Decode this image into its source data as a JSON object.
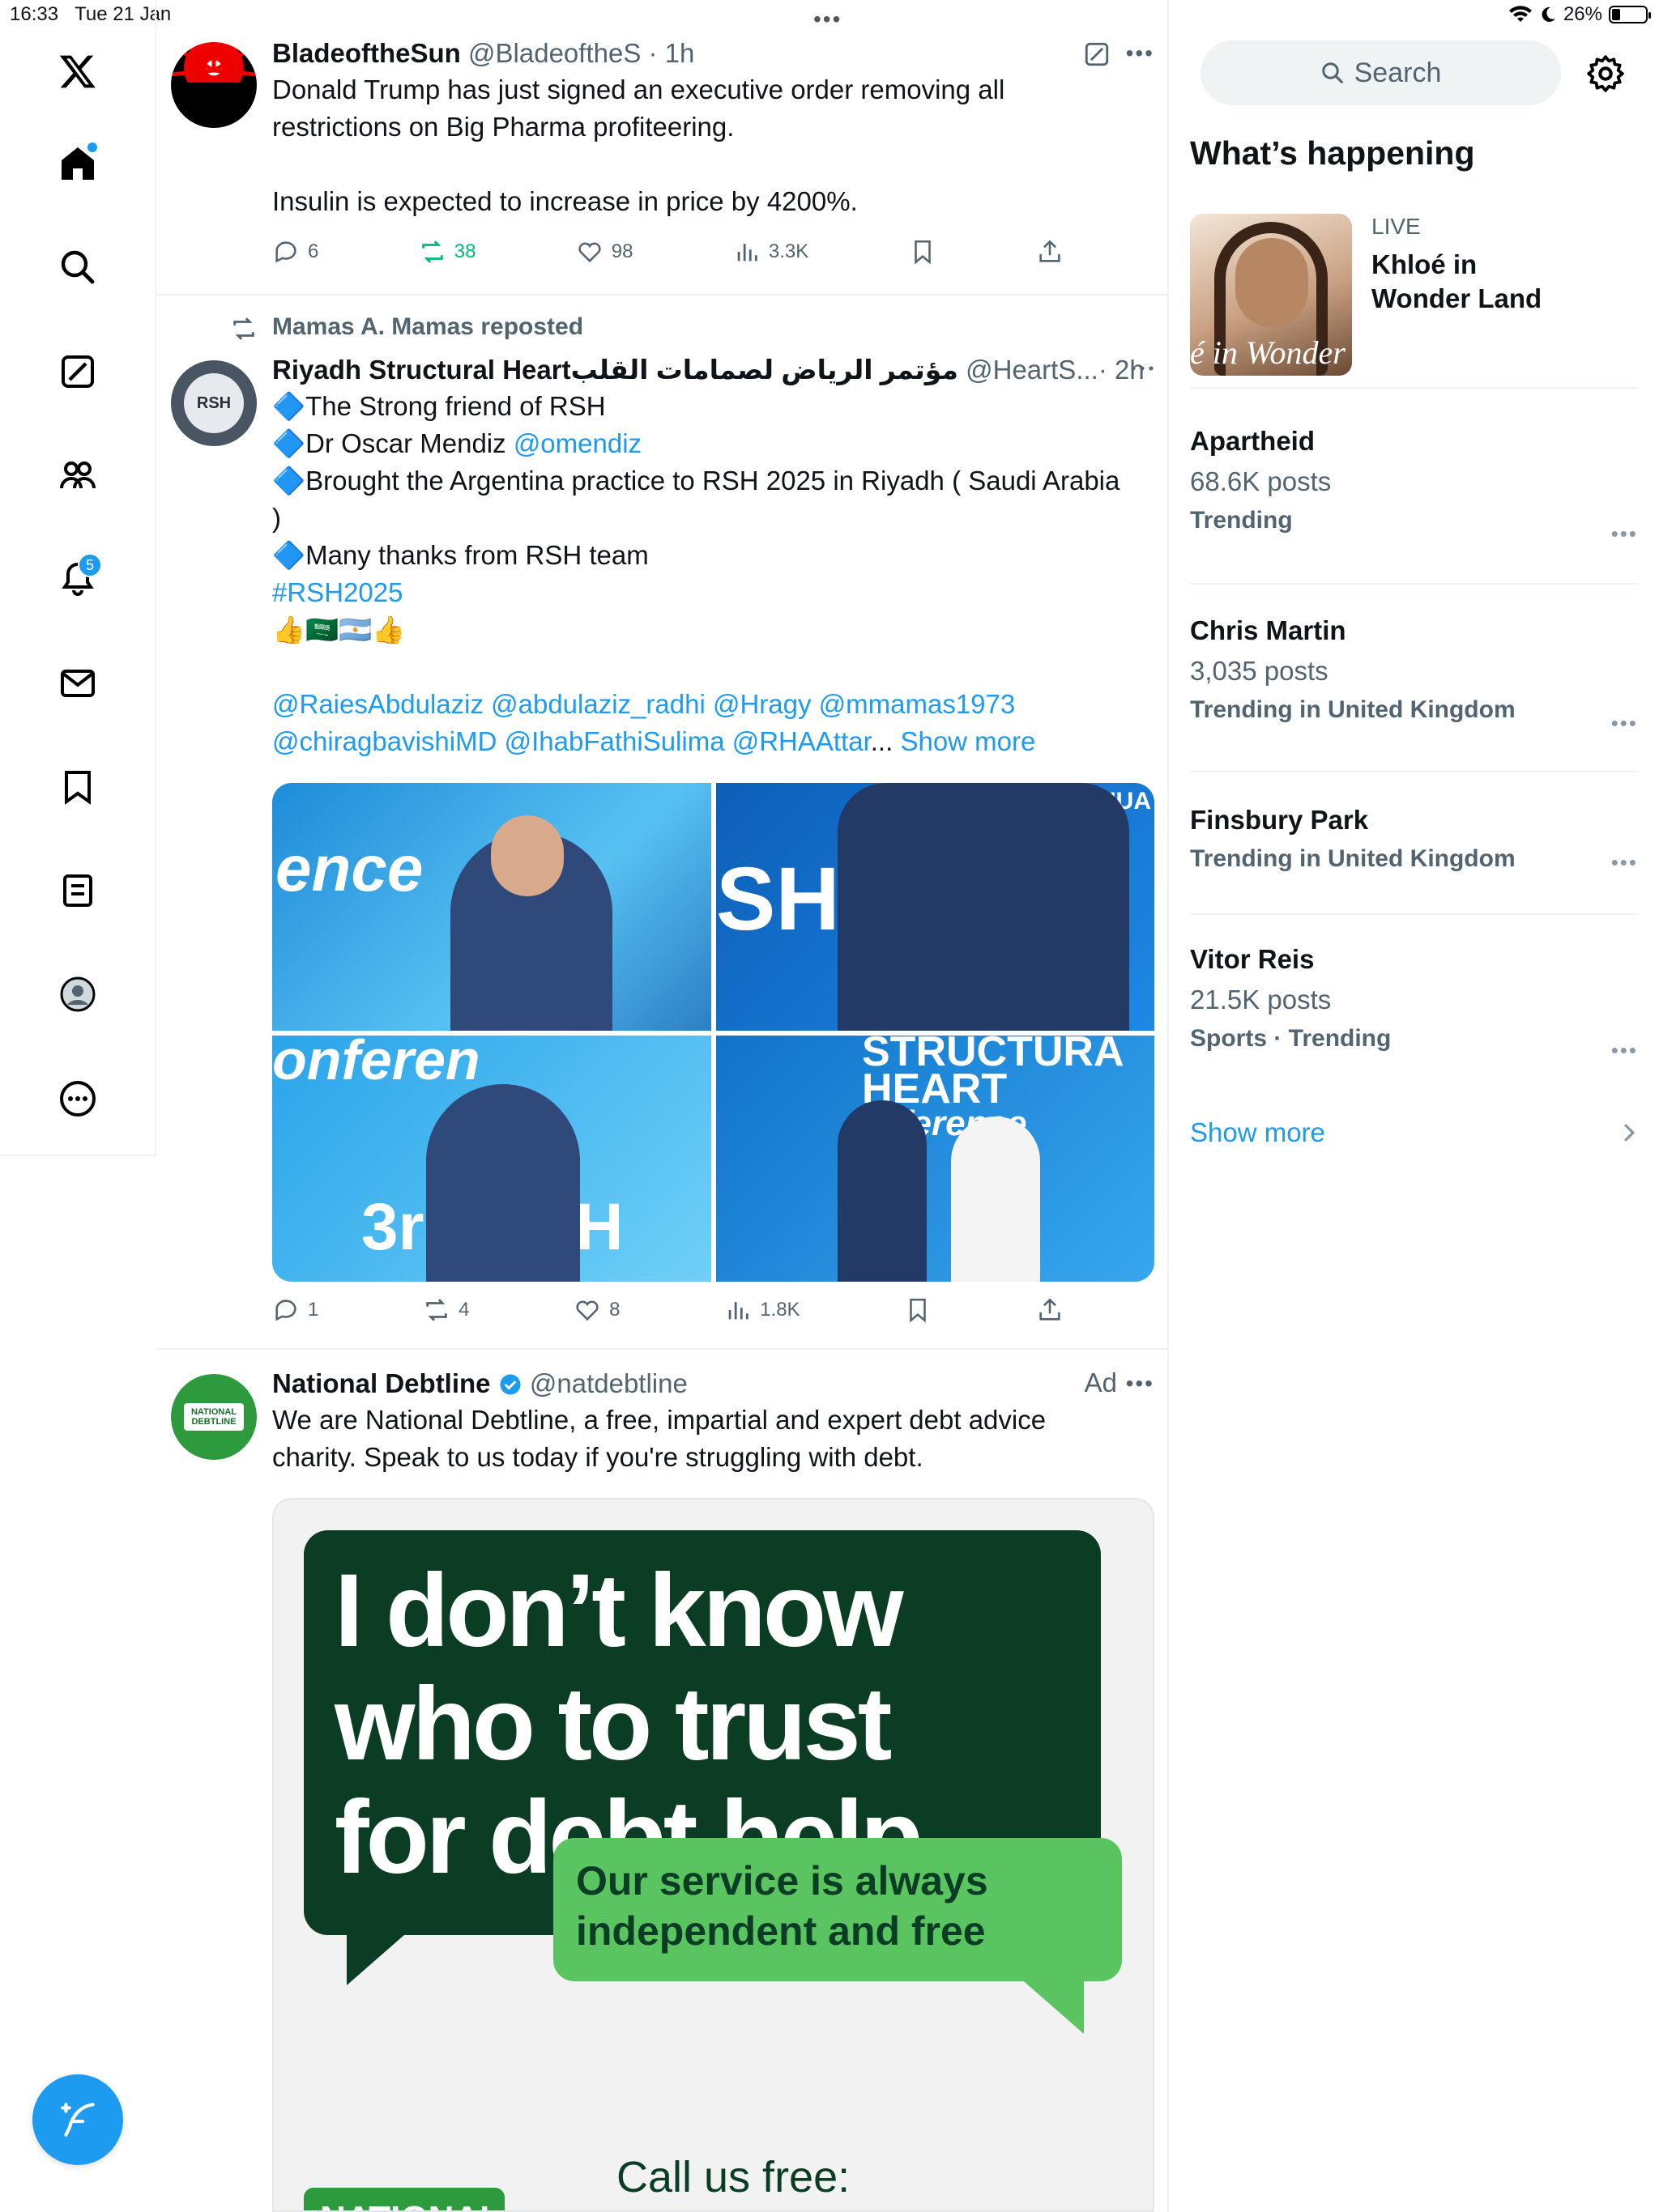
{
  "status_bar": {
    "time": "16:33",
    "date": "Tue 21 Jan",
    "battery": "26%",
    "battery_level": 0.26
  },
  "nav": {
    "items": [
      "home",
      "explore",
      "grok",
      "communities",
      "notifications",
      "messages",
      "bookmarks",
      "lists",
      "profile",
      "more"
    ],
    "notifications_count": "5"
  },
  "tweets": [
    {
      "name": "BladeoftheSun",
      "handle": "@BladeoftheS",
      "time": "· 1h",
      "text_lines": [
        "Donald Trump has just signed an executive order removing all",
        "restrictions on Big Pharma profiteering.",
        "Insulin is expected to increase in price by 4200%."
      ],
      "replies": "6",
      "reposts": "38",
      "likes": "98",
      "views": "3.3K"
    },
    {
      "repost_label": "Mamas A. Mamas reposted",
      "name": "Riyadh Structural Heartمؤتمر الرياض لصمامات القلب",
      "handle": "@HeartS...",
      "time": "· 2h",
      "lines": [
        "🔷The Strong friend of RSH",
        "🔷Dr Oscar Mendiz ",
        "🔷Brought the Argentina practice to RSH 2025 in Riyadh ( Saudi Arabia",
        ")",
        "🔷Many thanks from RSH team"
      ],
      "mention_omendiz": "@omendiz",
      "hashtag": "#RSH2025",
      "emoji_line": "👍🇸🇦🇦🇷👍",
      "mentions_line1": "@RaiesAbdulaziz @abdulaziz_radhi @Hragy @mmamas1973",
      "mentions_line2": "@chiragbavishiMD @IhabFathiSulima  @RHAAttar",
      "ellipsis": "...",
      "show_more": "Show more",
      "image_texts": [
        "ence",
        "SH",
        "JANUA",
        "onferen",
        "3rd RSH",
        "STRUCTURA",
        "HEART",
        "nference"
      ],
      "replies": "1",
      "reposts": "4",
      "likes": "8",
      "views": "1.8K"
    },
    {
      "name": "National Debtline",
      "handle": "@natdebtline",
      "ad_label": "Ad",
      "text_lines": [
        "We are National Debtline, a free, impartial and expert debt advice",
        "charity. Speak to us today if you're struggling with debt."
      ],
      "avatar_text": "NATIONAL DEBTLINE",
      "ad_headline": [
        "I don’t know",
        "who to trust",
        "for debt help"
      ],
      "ad_bubble": [
        "Our service is always",
        "independent and free"
      ],
      "ad_call": "Call us free:",
      "ad_logo": "NATIONAL"
    }
  ],
  "sidebar": {
    "search_placeholder": "Search",
    "whats_happening": "What’s happening",
    "live": {
      "label": "LIVE",
      "title_lines": [
        "Khloé in",
        "Wonder Land"
      ],
      "image_text": "é in Wonder l"
    },
    "trends": [
      {
        "name": "Apartheid",
        "posts": "68.6K posts",
        "context": "Trending"
      },
      {
        "name": "Chris Martin",
        "posts": "3,035 posts",
        "context": "Trending in United Kingdom"
      },
      {
        "name": "Finsbury Park",
        "posts": "",
        "context": "Trending in United Kingdom"
      },
      {
        "name": "Vitor Reis",
        "posts": "21.5K posts",
        "context": "Sports · Trending"
      }
    ],
    "show_more": "Show more"
  },
  "colors": {
    "accent": "#1d9bf0",
    "secondary_text": "#536471",
    "repost_green": "#00ba7c",
    "ad_green_dark": "#0b3d24",
    "ad_green_light": "#5ac460"
  }
}
